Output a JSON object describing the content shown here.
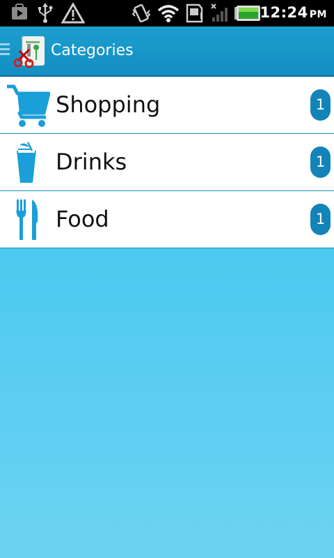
{
  "status_bar": {
    "time": "12:24",
    "ampm": "PM",
    "icons": [
      "play-store-notification-icon",
      "usb-icon",
      "warning-icon",
      "vibrate-icon",
      "wifi-icon",
      "sd-card-icon",
      "signal-icon",
      "battery-icon"
    ]
  },
  "action_bar": {
    "title": "Categories",
    "app_icon": "shopping-list-app-icon"
  },
  "categories": [
    {
      "label": "Shopping",
      "count": "1",
      "icon": "shopping-cart-icon"
    },
    {
      "label": "Drinks",
      "count": "1",
      "icon": "drink-glass-icon"
    },
    {
      "label": "Food",
      "count": "1",
      "icon": "fork-knife-icon"
    }
  ],
  "colors": {
    "accent": "#1d9ecf",
    "icon_blue": "#1b9fd8",
    "badge": "#1384b8",
    "background_top": "#2dc4ec",
    "background_bottom": "#6dd3f3"
  }
}
